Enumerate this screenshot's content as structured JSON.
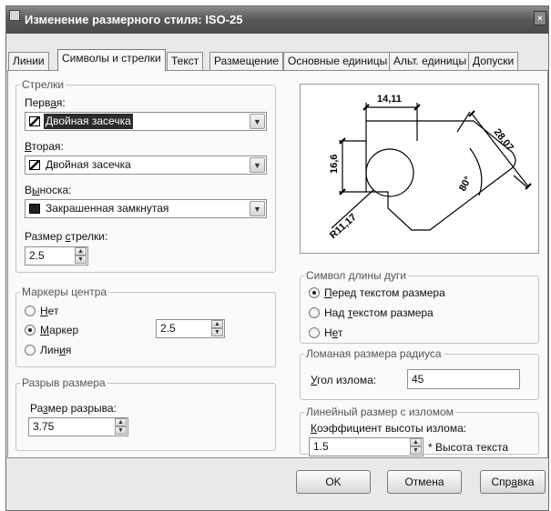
{
  "window": {
    "title": "Изменение размерного стиля: ISO-25",
    "title_button": "×"
  },
  "tabs": [
    {
      "label": "Линии"
    },
    {
      "label": "Символы и стрелки"
    },
    {
      "label": "Текст"
    },
    {
      "label": "Размещение"
    },
    {
      "label": "Основные единицы"
    },
    {
      "label": "Альт. единицы"
    },
    {
      "label": "Допуски"
    }
  ],
  "arrows": {
    "legend": "Стрелки",
    "first_label": "Перв",
    "first_label_ul": "а",
    "first_label_tail": "я:",
    "first_value": "Двойная засечка",
    "second_label_ul": "В",
    "second_label_tail": "торая:",
    "second_value": "Двойная засечка",
    "leader_label": "В",
    "leader_label_ul": "ы",
    "leader_label_tail": "носка:",
    "leader_value": "Закрашенная замкнутая",
    "size_label": "Размер ",
    "size_label_ul": "с",
    "size_label_tail": "трелки:",
    "size_value": "2.5"
  },
  "center_marks": {
    "legend": "Маркеры центра",
    "none_ul": "Н",
    "none_tail": "ет",
    "mark_ul": "М",
    "mark_tail": "аркер",
    "line_label": "Лин",
    "line_ul": "и",
    "line_tail": "я",
    "selected": "Маркер",
    "mark_value": "2.5"
  },
  "dim_break": {
    "legend": "Разрыв размера",
    "size_label": "Ра",
    "size_ul": "з",
    "size_tail": "мер разрыва:",
    "size_value": "3.75"
  },
  "arc_symbol": {
    "legend": "Символ длины дуги",
    "opt1_ul": "П",
    "opt1_tail": "еред текстом размера",
    "opt2_label": "Над ",
    "opt2_ul": "т",
    "opt2_tail": "екстом размера",
    "opt3_label": "Н",
    "opt3_ul": "е",
    "opt3_tail": "т",
    "selected": "Перед текстом размера"
  },
  "jog_radius": {
    "legend": "Ломаная размера радиуса",
    "angle_ul": "У",
    "angle_tail": "гол излома:",
    "angle_value": "45"
  },
  "linear_jog": {
    "legend": "Линейный размер с изломом",
    "factor_ul": "К",
    "factor_tail": "оэффициент высоты излома:",
    "factor_value": "1.5",
    "suffix": "* Высота текста"
  },
  "preview": {
    "dim_top": "14,11",
    "dim_left": "16,6",
    "dim_diag": "28,07",
    "dim_angle": "80°",
    "dim_radius": "R11,17"
  },
  "buttons": {
    "ok": "OK",
    "cancel": "Отмена",
    "help": "Спр",
    "help_ul": "а",
    "help_tail": "вка"
  }
}
